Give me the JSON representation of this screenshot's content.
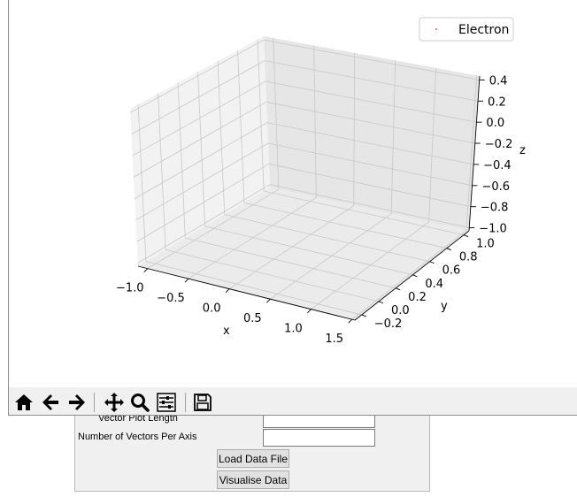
{
  "legend": {
    "label": "Electron",
    "marker_color": "#d62728"
  },
  "axes": {
    "x": {
      "label": "x",
      "ticks": [
        "−1.0",
        "−0.5",
        "0.0",
        "0.5",
        "1.0",
        "1.5"
      ]
    },
    "y": {
      "label": "y",
      "ticks": [
        "−0.2",
        "0.0",
        "0.2",
        "0.4",
        "0.6",
        "0.8",
        "1.0"
      ]
    },
    "z": {
      "label": "z",
      "ticks": [
        "0.4",
        "0.2",
        "0.0",
        "−0.2",
        "−0.4",
        "−0.6",
        "−0.8",
        "−1.0"
      ]
    }
  },
  "toolbar": {
    "buttons": [
      {
        "name": "home-icon",
        "icon": "home"
      },
      {
        "name": "back-icon",
        "icon": "arrow-left"
      },
      {
        "name": "forward-icon",
        "icon": "arrow-right"
      },
      {
        "name": "pan-icon",
        "icon": "move"
      },
      {
        "name": "zoom-icon",
        "icon": "magnifier"
      },
      {
        "name": "configure-subplots-icon",
        "icon": "sliders"
      },
      {
        "name": "save-icon",
        "icon": "floppy"
      }
    ]
  },
  "form": {
    "vector_plot_length_label": "Vector Plot Length",
    "vector_plot_length_value": "",
    "vectors_per_axis_label": "Number of Vectors Per Axis",
    "vectors_per_axis_value": "",
    "load_button": "Load Data File",
    "visualise_button": "Visualise Data"
  }
}
